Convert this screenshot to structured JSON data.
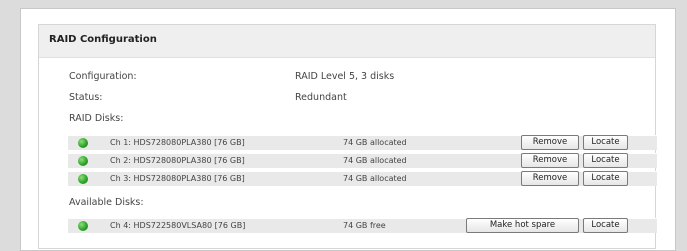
{
  "panel": {
    "title": "RAID Configuration"
  },
  "summary": {
    "configuration_label": "Configuration:",
    "configuration_value": "RAID Level 5, 3 disks",
    "status_label": "Status:",
    "status_value": "Redundant"
  },
  "raid_disks": {
    "label": "RAID Disks:",
    "items": [
      {
        "name": "Ch 1: HDS728080PLA380 [76 GB]",
        "allocation": "74 GB allocated",
        "remove_label": "Remove",
        "locate_label": "Locate",
        "status_color": "#2fa32a"
      },
      {
        "name": "Ch 2: HDS728080PLA380 [76 GB]",
        "allocation": "74 GB allocated",
        "remove_label": "Remove",
        "locate_label": "Locate",
        "status_color": "#2fa32a"
      },
      {
        "name": "Ch 3: HDS728080PLA380 [76 GB]",
        "allocation": "74 GB allocated",
        "remove_label": "Remove",
        "locate_label": "Locate",
        "status_color": "#2fa32a"
      }
    ]
  },
  "available_disks": {
    "label": "Available Disks:",
    "items": [
      {
        "name": "Ch 4: HDS722580VLSA80 [76 GB]",
        "allocation": "74 GB free",
        "hot_spare_label": "Make hot spare",
        "locate_label": "Locate",
        "status_color": "#2fa32a"
      }
    ]
  }
}
